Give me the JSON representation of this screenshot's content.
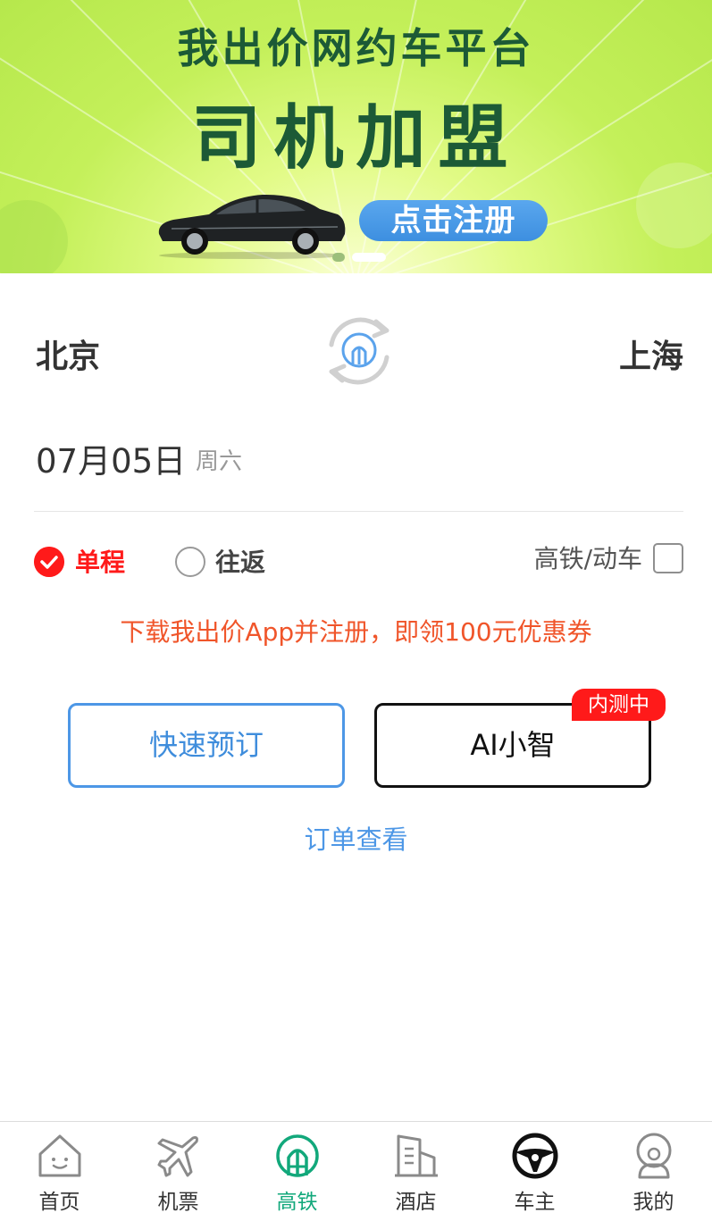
{
  "banner": {
    "title_line1": "我出价网约车平台",
    "title_line2": "司机加盟",
    "cta_label": "点击注册",
    "slide_count": 2,
    "active_slide": 2
  },
  "search": {
    "from_station": "北京",
    "to_station": "上海",
    "date": "07月05日",
    "weekday": "周六",
    "trip_types": [
      {
        "label": "单程",
        "checked": true
      },
      {
        "label": "往返",
        "checked": false
      }
    ],
    "high_speed_only_label": "高铁/动车",
    "high_speed_only_checked": false
  },
  "promo_text": "下载我出价App并注册，即领100元优惠券",
  "actions": {
    "quick_book_label": "快速预订",
    "ai_label": "AI小智",
    "ai_badge": "内测中",
    "orders_link": "订单查看"
  },
  "tabbar": {
    "items": [
      {
        "label": "首页",
        "icon": "home-icon",
        "active": false
      },
      {
        "label": "机票",
        "icon": "airplane-icon",
        "active": false
      },
      {
        "label": "高铁",
        "icon": "train-icon",
        "active": true
      },
      {
        "label": "酒店",
        "icon": "building-icon",
        "active": false
      },
      {
        "label": "车主",
        "icon": "steering-wheel-icon",
        "active": false
      },
      {
        "label": "我的",
        "icon": "profile-icon",
        "active": false
      }
    ]
  },
  "colors": {
    "brand_green": "#12a87b",
    "alert_red": "#ff1a1a",
    "link_blue": "#4d97e6",
    "promo_orange": "#f0552a",
    "banner_text_green": "#1c5a36"
  }
}
